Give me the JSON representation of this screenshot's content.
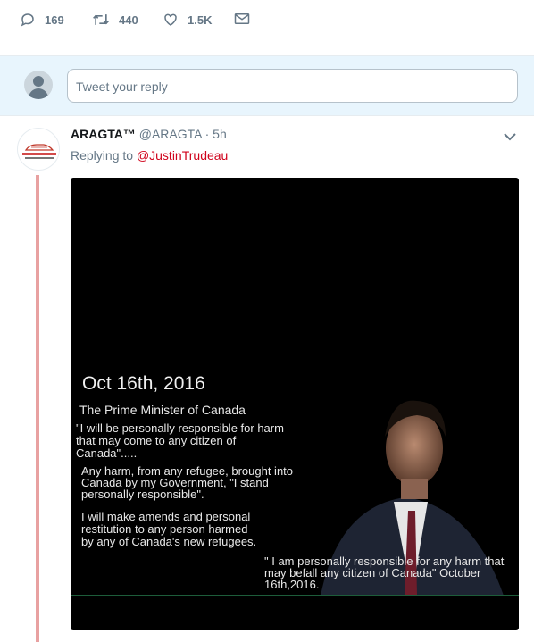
{
  "actions": {
    "reply_count": "169",
    "retweet_count": "440",
    "like_count": "1.5K"
  },
  "reply_box": {
    "placeholder": "Tweet your reply"
  },
  "tweet": {
    "name": "ARAGTA™",
    "handle": "@ARAGTA",
    "separator": "·",
    "time": "5h",
    "replying_prefix": "Replying to",
    "replying_to": "@JustinTrudeau",
    "image_text": {
      "date": "Oct 16th, 2016",
      "title": "The Prime Minister of Canada",
      "quote1": "\"I will be personally responsible for harm that may come to any citizen of Canada\".....",
      "quote2": "Any harm, from any refugee, brought into Canada by my Government, \"I stand personally responsible\".",
      "quote3": "I will make amends and personal restitution to any person harmed by any of Canada's new refugees.",
      "quote4": "\" I am personally responsible for any harm that may befall any citizen of Canada\" October 16th,2016."
    }
  },
  "colors": {
    "accent_mention": "#d0021b",
    "thread_line": "#e8a1a1",
    "reply_bar_bg": "#e8f5fd"
  },
  "icons": [
    "reply-icon",
    "retweet-icon",
    "like-icon",
    "message-icon",
    "chevron-down-icon"
  ]
}
